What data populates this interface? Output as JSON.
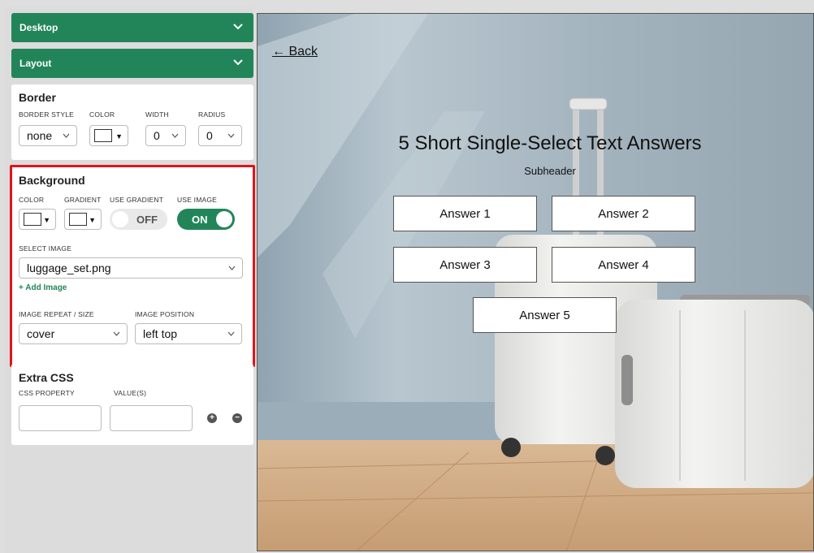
{
  "sidebar": {
    "accordions": [
      {
        "label": "Desktop"
      },
      {
        "label": "Layout"
      }
    ],
    "border": {
      "title": "Border",
      "labels": {
        "style": "BORDER STYLE",
        "color": "COLOR",
        "width": "WIDTH",
        "radius": "RADIUS"
      },
      "values": {
        "style": "none",
        "width": "0",
        "radius": "0"
      }
    },
    "background": {
      "title": "Background",
      "labels": {
        "color": "COLOR",
        "gradient": "GRADIENT",
        "use_gradient": "USE GRADIENT",
        "use_image": "USE IMAGE",
        "select_image": "SELECT IMAGE",
        "repeat_size": "IMAGE REPEAT / SIZE",
        "position": "IMAGE POSITION"
      },
      "use_gradient": "OFF",
      "use_image": "ON",
      "image": "luggage_set.png",
      "add_image": "+ Add Image",
      "repeat_size": "cover",
      "position": "left top"
    },
    "extra_css": {
      "title": "Extra CSS",
      "labels": {
        "property": "CSS PROPERTY",
        "values": "VALUE(S)"
      },
      "add": "+",
      "remove": "−"
    }
  },
  "preview": {
    "back": "← Back",
    "title": "5 Short Single-Select Text Answers",
    "subheader": "Subheader",
    "answers": [
      "Answer 1",
      "Answer 2",
      "Answer 3",
      "Answer 4",
      "Answer 5"
    ]
  },
  "colors": {
    "accent": "#22855a",
    "highlight": "#e0141a"
  }
}
